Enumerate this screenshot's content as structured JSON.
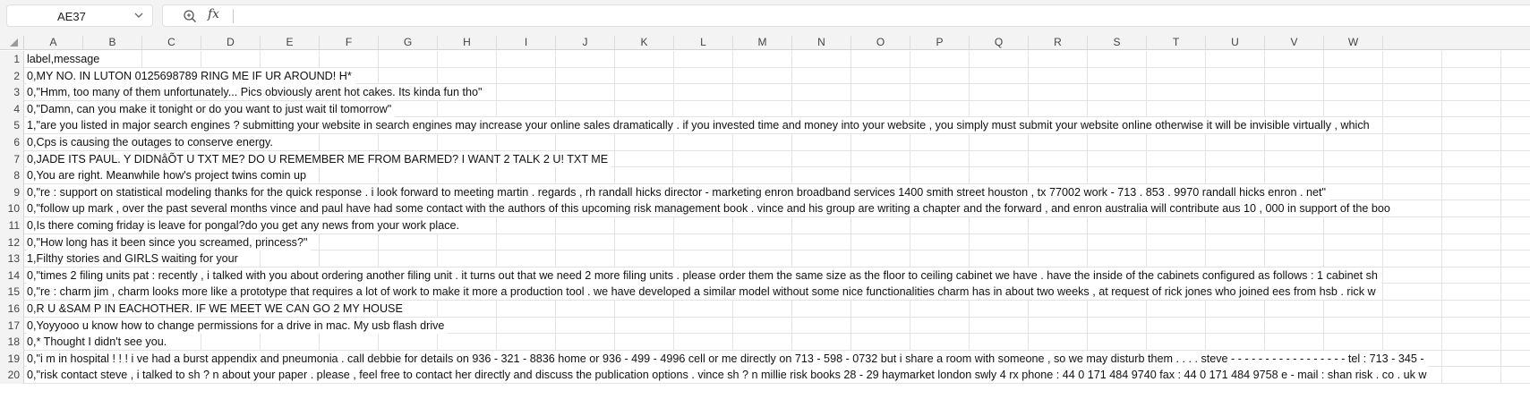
{
  "formula_bar": {
    "cell_reference": "AE37",
    "fx_symbol": "fx",
    "formula": ""
  },
  "columns": [
    "A",
    "B",
    "C",
    "D",
    "E",
    "F",
    "G",
    "H",
    "I",
    "J",
    "K",
    "L",
    "M",
    "N",
    "O",
    "P",
    "Q",
    "R",
    "S",
    "T",
    "U",
    "V",
    "W"
  ],
  "rows": [
    {
      "num": "1",
      "text": "label,message"
    },
    {
      "num": "2",
      "text": "0,MY NO. IN LUTON 0125698789 RING ME IF UR AROUND! H*"
    },
    {
      "num": "3",
      "text": "0,\"Hmm, too many of them unfortunately... Pics obviously arent hot cakes. Its kinda fun tho\""
    },
    {
      "num": "4",
      "text": "0,\"Damn, can you make it tonight or do you want to just wait til tomorrow\""
    },
    {
      "num": "5",
      "text": "1,\"are you listed in major search engines ? submitting your website in search engines may increase your online sales dramatically . if you invested time and money into your website , you simply must submit your website online otherwise it will be invisible virtually , which"
    },
    {
      "num": "6",
      "text": "0,Cps is causing the outages to conserve energy."
    },
    {
      "num": "7",
      "text": "0,JADE ITS PAUL. Y DIDNåÕT U TXT ME? DO U REMEMBER ME FROM BARMED? I WANT 2 TALK 2 U! TXT ME"
    },
    {
      "num": "8",
      "text": "0,You are right. Meanwhile how's project twins comin up"
    },
    {
      "num": "9",
      "text": "0,\"re : support on statistical modeling thanks for the quick response . i look forward to meeting martin . regards , rh randall hicks director - marketing enron broadband services 1400 smith street houston , tx 77002 work - 713 . 853 . 9970 randall hicks enron . net\""
    },
    {
      "num": "10",
      "text": "0,\"follow up mark , over the past several months vince and paul have had some contact with the authors of this upcoming risk management book . vince and his group are writing a chapter and the forward , and enron australia will contribute aus 10 , 000 in support of the boo"
    },
    {
      "num": "11",
      "text": "0,Is there coming friday is leave for pongal?do you get any news from your work place."
    },
    {
      "num": "12",
      "text": "0,\"How long has it been since you screamed, princess?\""
    },
    {
      "num": "13",
      "text": "1,Filthy stories and GIRLS waiting for your"
    },
    {
      "num": "14",
      "text": "0,\"times 2 filing units pat : recently , i talked with you about ordering another filing unit . it turns out that we need 2 more filing units . please order them the same size as the floor to ceiling cabinet we have . have the inside of the cabinets configured as follows : 1 cabinet sh"
    },
    {
      "num": "15",
      "text": "0,\"re : charm jim , charm looks more like a prototype that requires a lot of work to make it more a production tool . we have developed a similar model without some nice functionalities charm has in about two weeks , at request of rick jones who joined ees from hsb . rick w"
    },
    {
      "num": "16",
      "text": "0,R U &SAM P IN EACHOTHER. IF WE MEET WE CAN GO 2 MY HOUSE"
    },
    {
      "num": "17",
      "text": "0,Yoyyooo u know how to change permissions for a drive in mac. My usb flash drive"
    },
    {
      "num": "18",
      "text": "0,* Thought I didn't see you."
    },
    {
      "num": "19",
      "text": "0,\"i m in hospital ! ! ! i ve had a burst appendix and pneumonia . call debbie for details on 936 - 321 - 8836 home or 936 - 499 - 4996 cell or me directly on 713 - 598 - 0732 but i share a room with someone , so we may disturb them . . . . steve - - - - - - - - - - - - - - - - - tel : 713 - 345 -"
    },
    {
      "num": "20",
      "text": "0,\"risk contact steve , i talked to sh ? n about your paper . please , feel free to contact her directly and discuss the publication options . vince sh ? n millie risk books 28 - 29 haymarket london swly 4 rx phone : 44 0 171 484 9740 fax : 44 0 171 484 9758 e - mail : shan risk . co . uk w"
    }
  ]
}
